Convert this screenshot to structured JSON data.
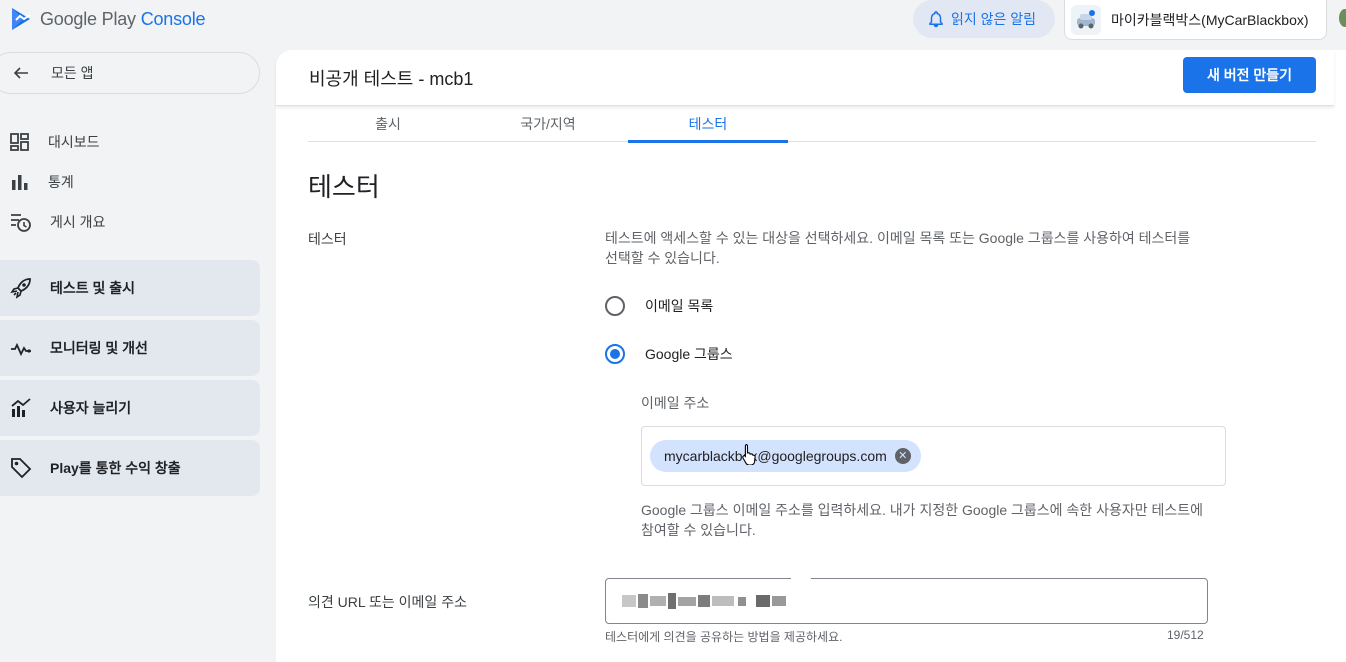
{
  "app": {
    "logo_text_play": "Google Play",
    "logo_text_console": "Console"
  },
  "topbar": {
    "notifications_label": "읽지 않은 알림",
    "account_name": "마이카블랙박스(MyCarBlackbox)"
  },
  "sidebar": {
    "back_label": "모든 앱",
    "items": [
      {
        "label": "대시보드",
        "icon": "dashboard-icon"
      },
      {
        "label": "통계",
        "icon": "bar-chart-icon"
      },
      {
        "label": "게시 개요",
        "icon": "publishing-overview-icon"
      }
    ],
    "groups": [
      {
        "label": "테스트 및 출시",
        "icon": "rocket-icon"
      },
      {
        "label": "모니터링 및 개선",
        "icon": "vitals-icon"
      },
      {
        "label": "사용자 늘리기",
        "icon": "grow-users-icon"
      },
      {
        "label": "Play를 통한 수익 창출",
        "icon": "tag-icon"
      }
    ]
  },
  "header": {
    "title": "비공개 테스트 - mcb1",
    "create_release_label": "새 버전 만들기"
  },
  "tabs": [
    {
      "label": "출시",
      "active": false
    },
    {
      "label": "국가/지역",
      "active": false
    },
    {
      "label": "테스터",
      "active": true
    }
  ],
  "testers": {
    "section_title": "테스터",
    "field_label": "테스터",
    "description": "테스트에 액세스할 수 있는 대상을 선택하세요. 이메일 목록 또는 Google 그룹스를 사용하여 테스터를 선택할 수 있습니다.",
    "options": [
      {
        "label": "이메일 목록",
        "checked": false
      },
      {
        "label": "Google 그룹스",
        "checked": true
      }
    ],
    "email_label": "이메일 주소",
    "chip_value": "mycarblackbox@googlegroups.com",
    "help_text": "Google 그룹스 이메일 주소를 입력하세요. 내가 지정한 Google 그룹스에 속한 사용자만 테스트에 참여할 수 있습니다."
  },
  "feedback": {
    "label": "의견 URL 또는 이메일 주소",
    "hint": "테스터에게 의견을 공유하는 방법을 제공하세요.",
    "counter": "19/512"
  },
  "colors": {
    "accent": "#1a73e8",
    "chip": "#d3e3fd",
    "background": "#f1f3f4"
  }
}
